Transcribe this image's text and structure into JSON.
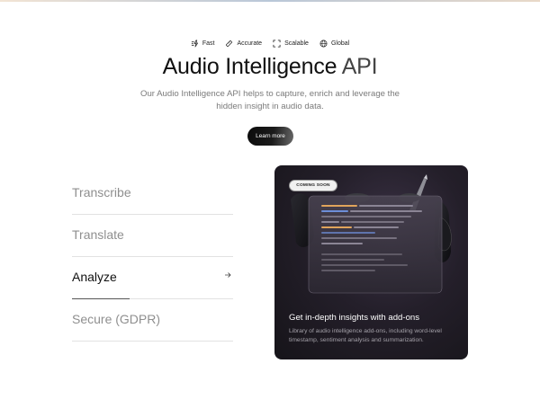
{
  "features": [
    {
      "icon": "lightning-icon",
      "label": "Fast"
    },
    {
      "icon": "ruler-icon",
      "label": "Accurate"
    },
    {
      "icon": "expand-icon",
      "label": "Scalable"
    },
    {
      "icon": "globe-icon",
      "label": "Global"
    }
  ],
  "hero": {
    "title_main": "Audio Intelligence",
    "title_accent": " API",
    "subtitle": "Our Audio Intelligence API helps to capture, enrich and leverage the hidden insight in audio data.",
    "cta_label": "Learn more"
  },
  "tabs": [
    {
      "label": "Transcribe",
      "active": false
    },
    {
      "label": "Translate",
      "active": false
    },
    {
      "label": "Analyze",
      "active": true,
      "progress_percent": 36
    },
    {
      "label": "Secure (GDPR)",
      "active": false
    }
  ],
  "card": {
    "badge": "COMING SOON",
    "title": "Get in-depth insights with add-ons",
    "description": "Library of audio intelligence add-ons, including word-level timestamp, sentiment analysis and summarization."
  },
  "colors": {
    "card_bg": "#1c1920",
    "accent_orange": "#e0a45b",
    "accent_blue": "#6d8ed8"
  }
}
